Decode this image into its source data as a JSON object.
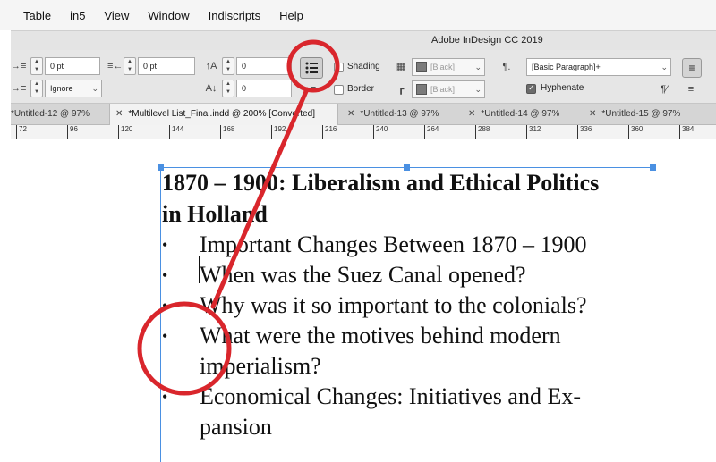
{
  "menubar": [
    "Table",
    "in5",
    "View",
    "Window",
    "Indiscripts",
    "Help"
  ],
  "titlebar": {
    "title": "Adobe InDesign CC 2019"
  },
  "control": {
    "left_indent": "0 pt",
    "right_indent": "0 pt",
    "first_line_value": "Ignore",
    "space_before": "0",
    "space_after": "0",
    "space_left": "0",
    "space_bottom": "0",
    "shading_label": "Shading",
    "border_label": "Border",
    "shading_color": "[Black]",
    "border_color": "[Black]",
    "paragraph_style": "[Basic Paragraph]+",
    "hyphenate_label": "Hyphenate",
    "hyphenate_checked": true
  },
  "tabs": [
    {
      "label": "*Untitled-12 @ 97%",
      "active": false
    },
    {
      "label": "*Multilevel List_Final.indd @ 200% [Converted]",
      "active": true
    },
    {
      "label": "*Untitled-13 @ 97%",
      "active": false
    },
    {
      "label": "*Untitled-14 @ 97%",
      "active": false
    },
    {
      "label": "*Untitled-15 @ 97%",
      "active": false
    }
  ],
  "ruler": [
    "72",
    "96",
    "120",
    "144",
    "168",
    "192",
    "216",
    "240",
    "264",
    "288",
    "312",
    "336",
    "360",
    "384"
  ],
  "document": {
    "heading_line1": "1870 – 1900: Liberalism and Ethical Politics",
    "heading_line2": "in Holland",
    "items": [
      {
        "bullet": "•",
        "lines": [
          "Important Changes Between 1870 – 1900"
        ]
      },
      {
        "bullet": "•",
        "lines": [
          "When was the Suez Canal opened?"
        ]
      },
      {
        "bullet": "•",
        "lines": [
          "Why was it so important to the colonials?"
        ]
      },
      {
        "bullet": "•",
        "lines": [
          "What were the motives behind modern",
          "imperialism?"
        ]
      },
      {
        "bullet": "•",
        "lines": [
          "Economical Changes: Initiatives and Ex-",
          "pansion"
        ]
      }
    ]
  },
  "colors": {
    "selection_blue": "#4a90e2",
    "annotation_red": "#d9262c"
  }
}
